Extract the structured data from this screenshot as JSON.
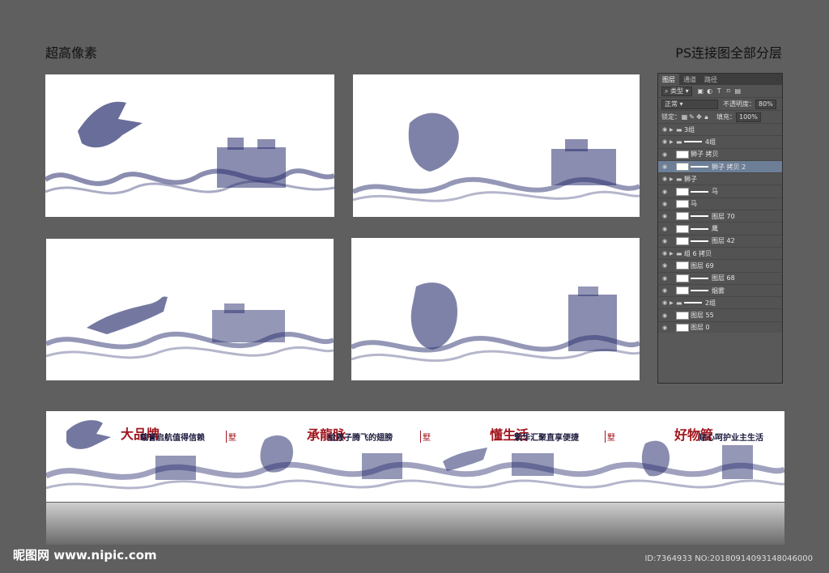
{
  "header": {
    "left": "超高像素",
    "right": "PS连接图全部分层"
  },
  "layers_panel": {
    "tabs": [
      "图层",
      "通道",
      "路径"
    ],
    "filter_kind": "类型",
    "blend_mode": "正常",
    "opacity_label": "不透明度：",
    "opacity": "80%",
    "lock_label": "锁定：",
    "fill_label": "填充：",
    "fill": "100%",
    "layers": [
      {
        "name": "3组",
        "type": "group"
      },
      {
        "name": "4组",
        "type": "group-mask"
      },
      {
        "name": "狮子 拷贝",
        "type": "layer"
      },
      {
        "name": "狮子 拷贝 2",
        "type": "layer-mask",
        "selected": true
      },
      {
        "name": "狮子",
        "type": "group"
      },
      {
        "name": "马",
        "type": "layer-mask"
      },
      {
        "name": "马",
        "type": "layer"
      },
      {
        "name": "图层 70",
        "type": "layer-mask"
      },
      {
        "name": "鹰",
        "type": "layer-mask"
      },
      {
        "name": "图层 42",
        "type": "layer-mask"
      },
      {
        "name": "组 6 拷贝",
        "type": "group"
      },
      {
        "name": "图层 69",
        "type": "layer"
      },
      {
        "name": "图层 68",
        "type": "layer-mask"
      },
      {
        "name": "烟雾",
        "type": "layer-mask"
      },
      {
        "name": "2组",
        "type": "group-mask"
      },
      {
        "name": "图层 55",
        "type": "layer"
      },
      {
        "name": "图层 0",
        "type": "layer"
      }
    ]
  },
  "banner": {
    "slogans": [
      "载誉启航值得信赖",
      "给孩子腾飞的翅膀",
      "繁华汇聚直享便捷",
      "贴心呵护业主生活"
    ],
    "calligraphy": [
      "大品牌",
      "承龍脉",
      "懂生活",
      "好物管"
    ],
    "logo": "墅"
  },
  "footer": {
    "watermark": "昵图网 www.nipic.com",
    "id": "ID:7364933 NO:20180914093148046000"
  },
  "colors": {
    "ink": "#2a2f6e",
    "page_bg": "#5f5f5f",
    "accent_red": "#a0161e"
  }
}
